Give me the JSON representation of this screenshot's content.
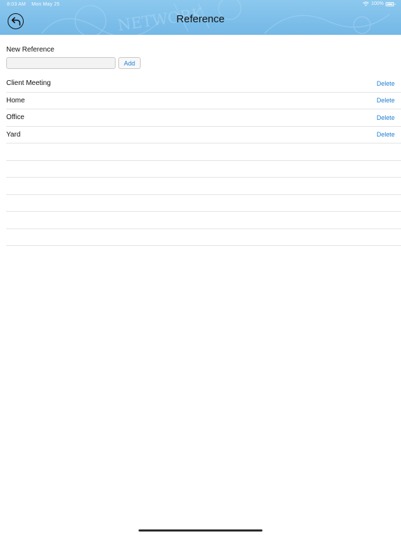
{
  "status_bar": {
    "time": "8:03 AM",
    "date": "Mon May 25",
    "battery_text": "100%",
    "wifi_icon": "wifi-icon",
    "battery_icon": "battery-icon",
    "battery_level": 1.0
  },
  "header": {
    "title": "Reference",
    "back_icon": "back-arrow-icon",
    "background_color": "#7ebfea",
    "background_text": "NETWORK"
  },
  "form": {
    "label": "New Reference",
    "input_value": "",
    "input_placeholder": "",
    "add_label": "Add"
  },
  "references": [
    {
      "label": "Client Meeting",
      "delete_label": "Delete"
    },
    {
      "label": "Home",
      "delete_label": "Delete"
    },
    {
      "label": "Office",
      "delete_label": "Delete"
    },
    {
      "label": "Yard",
      "delete_label": "Delete"
    }
  ],
  "colors": {
    "accent": "#1f7fd4",
    "separator": "#e4e4e4"
  }
}
